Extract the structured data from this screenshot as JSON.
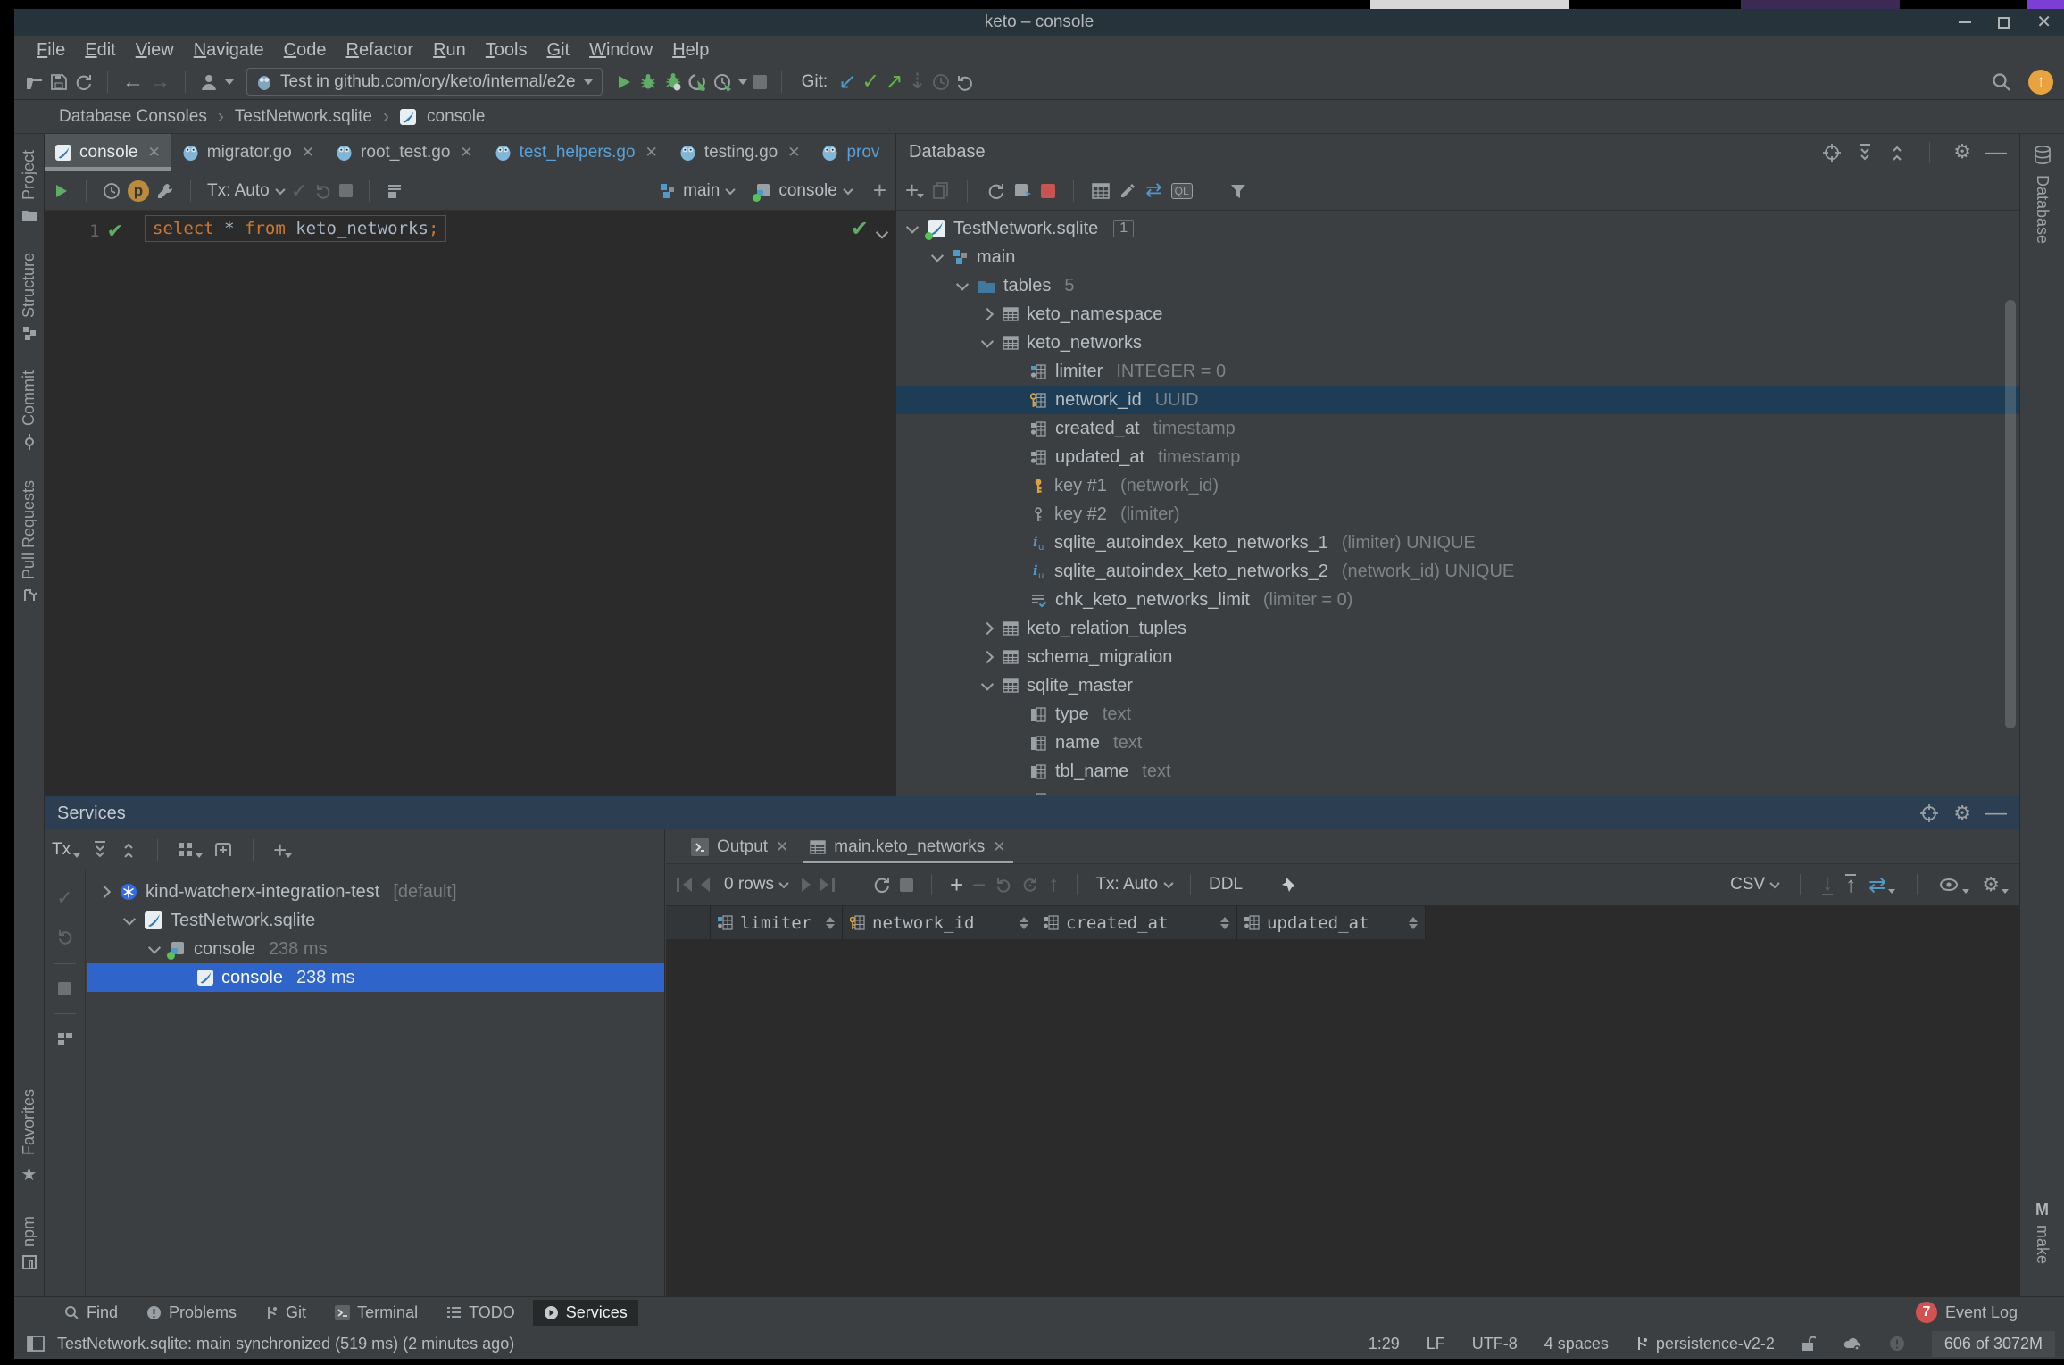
{
  "window": {
    "title": "keto – console"
  },
  "menu": {
    "items": [
      "File",
      "Edit",
      "View",
      "Navigate",
      "Code",
      "Refactor",
      "Run",
      "Tools",
      "Git",
      "Window",
      "Help"
    ]
  },
  "main_toolbar": {
    "run_config": "Test in github.com/ory/keto/internal/e2e",
    "git_label": "Git:"
  },
  "breadcrumbs": {
    "items": [
      "Database Consoles",
      "TestNetwork.sqlite",
      "console"
    ]
  },
  "editor_tabs": {
    "tabs": [
      {
        "label": "console"
      },
      {
        "label": "migrator.go"
      },
      {
        "label": "root_test.go"
      },
      {
        "label": "test_helpers.go"
      },
      {
        "label": "testing.go"
      },
      {
        "label": "prov"
      }
    ]
  },
  "editor": {
    "line_number": "1",
    "sql": {
      "keyword1": "select",
      "star": "*",
      "keyword2": "from",
      "identifier": "keto_networks",
      "semicolon": ";"
    },
    "tx_mode": "Tx: Auto",
    "schema_selector": "main",
    "session_selector": "console"
  },
  "database_panel": {
    "title": "Database",
    "tree": [
      {
        "label": "TestNetwork.sqlite",
        "badge": "1"
      },
      {
        "label": "main"
      },
      {
        "label": "tables",
        "count": "5"
      },
      {
        "label": "keto_namespace"
      },
      {
        "label": "keto_networks"
      },
      {
        "label": "limiter",
        "type": "INTEGER = 0"
      },
      {
        "label": "network_id",
        "type": "UUID"
      },
      {
        "label": "created_at",
        "type": "timestamp"
      },
      {
        "label": "updated_at",
        "type": "timestamp"
      },
      {
        "label": "key #1",
        "type": "(network_id)"
      },
      {
        "label": "key #2",
        "type": "(limiter)"
      },
      {
        "label": "sqlite_autoindex_keto_networks_1",
        "type": "(limiter) UNIQUE"
      },
      {
        "label": "sqlite_autoindex_keto_networks_2",
        "type": "(network_id) UNIQUE"
      },
      {
        "label": "chk_keto_networks_limit",
        "type": "(limiter = 0)"
      },
      {
        "label": "keto_relation_tuples"
      },
      {
        "label": "schema_migration"
      },
      {
        "label": "sqlite_master"
      },
      {
        "label": "type",
        "type": "text"
      },
      {
        "label": "name",
        "type": "text"
      },
      {
        "label": "tbl_name",
        "type": "text"
      }
    ]
  },
  "services": {
    "title": "Services",
    "tx_label": "Tx",
    "tree": [
      {
        "label": "kind-watcherx-integration-test",
        "suffix": "[default]"
      },
      {
        "label": "TestNetwork.sqlite"
      },
      {
        "label": "console",
        "suffix": "238 ms"
      },
      {
        "label": "console",
        "suffix": "238 ms"
      }
    ],
    "output_tabs": [
      {
        "label": "Output"
      },
      {
        "label": "main.keto_networks"
      }
    ],
    "grid": {
      "rows_count": "0 rows",
      "tx_mode": "Tx: Auto",
      "ddl_label": "DDL",
      "format": "CSV",
      "columns": [
        "limiter",
        "network_id",
        "created_at",
        "updated_at"
      ]
    }
  },
  "left_bar": {
    "top": [
      {
        "label": "Project"
      },
      {
        "label": "Structure"
      },
      {
        "label": "Commit"
      },
      {
        "label": "Pull Requests"
      }
    ],
    "bottom": [
      {
        "label": "Favorites"
      },
      {
        "label": "npm"
      }
    ]
  },
  "right_bar": {
    "top": "Database",
    "bottom": "make",
    "make_icon": "M"
  },
  "bottom_bar": {
    "items": [
      {
        "label": "Find"
      },
      {
        "label": "Problems"
      },
      {
        "label": "Git"
      },
      {
        "label": "Terminal"
      },
      {
        "label": "TODO"
      },
      {
        "label": "Services"
      }
    ],
    "event_log": {
      "count": "7",
      "label": "Event Log"
    }
  },
  "status_bar": {
    "message": "TestNetwork.sqlite: main synchronized (519 ms) (2 minutes ago)",
    "caret": "1:29",
    "line_separator": "LF",
    "encoding": "UTF-8",
    "indent": "4 spaces",
    "branch": "persistence-v2-2",
    "memory": "606 of 3072M"
  },
  "colors": {
    "accent_blue": "#3592c4",
    "selection_focused": "#2f65ca",
    "selection_unfocused": "#1d3c56",
    "keyword_orange": "#cc7832",
    "run_green": "#5fad65",
    "stop_red": "#c75450",
    "update_orange": "#e8a33d",
    "badge_red": "#d25252"
  }
}
